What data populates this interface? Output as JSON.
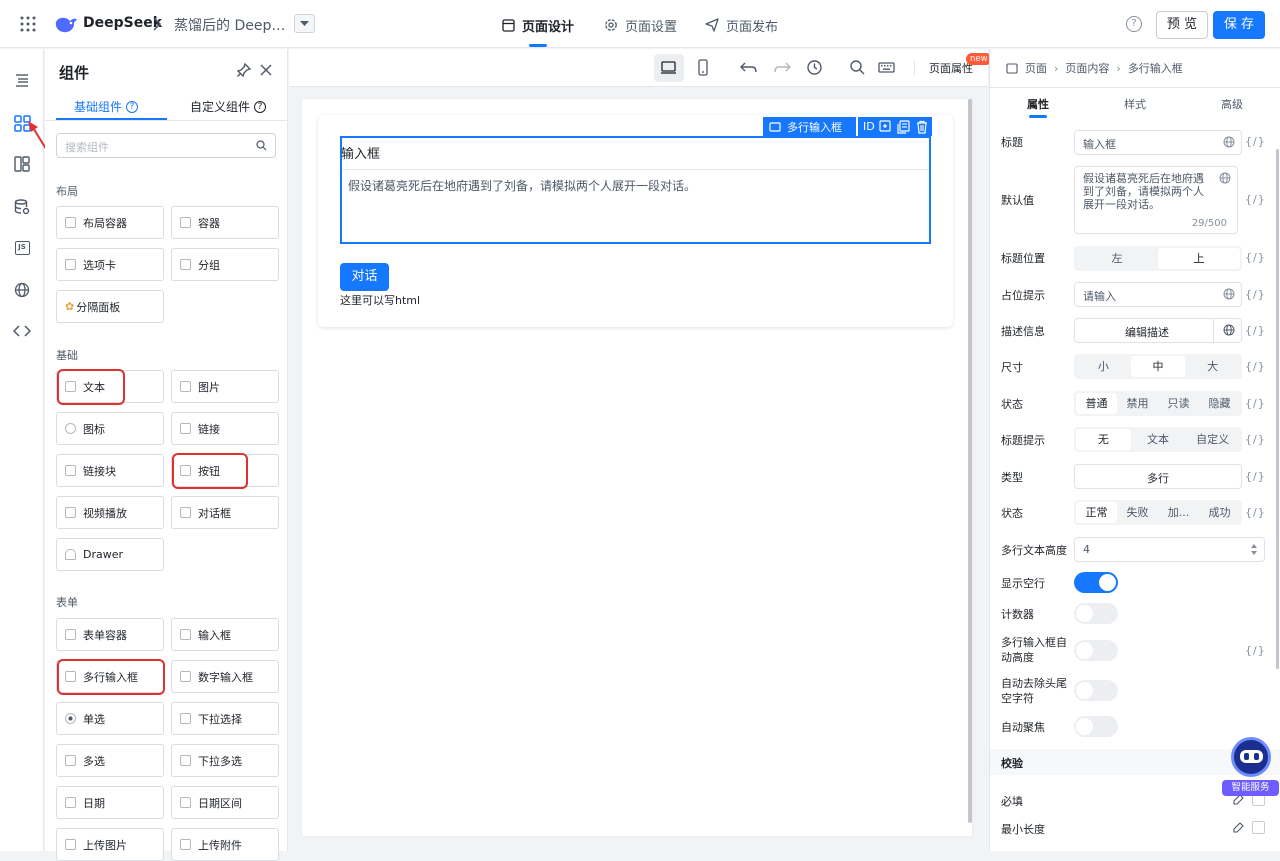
{
  "topbar": {
    "brand": "DeepSeek",
    "app_name": "蒸馏后的 DeepSeek",
    "tabs": [
      "页面设计",
      "页面设置",
      "页面发布"
    ],
    "help": "?",
    "preview": "预 览",
    "save": "保 存"
  },
  "rail": {
    "icons": [
      "outline-icon",
      "components-icon",
      "layout-icon",
      "datasource-icon",
      "js-icon",
      "globe-icon",
      "code-icon"
    ],
    "js_label": "JS"
  },
  "panel": {
    "title": "组件",
    "tabs": [
      "基础组件",
      "自定义组件"
    ],
    "search_placeholder": "搜索组件",
    "sections": {
      "layout": {
        "title": "布局",
        "items": [
          "布局容器",
          "容器",
          "选项卡",
          "分组",
          "分隔面板"
        ]
      },
      "basic": {
        "title": "基础",
        "items": [
          "文本",
          "图片",
          "图标",
          "链接",
          "链接块",
          "按钮",
          "视频播放",
          "对话框",
          "Drawer"
        ]
      },
      "form": {
        "title": "表单",
        "items": [
          "表单容器",
          "输入框",
          "多行输入框",
          "数字输入框",
          "单选",
          "下拉选择",
          "多选",
          "下拉多选",
          "日期",
          "日期区间",
          "上传图片",
          "上传附件"
        ]
      }
    }
  },
  "canvas_toolbar": {
    "page_props": "页面属性",
    "new_badge": "new"
  },
  "canvas": {
    "selected_label": "多行输入框",
    "id_label": "ID",
    "textarea_label": "输入框",
    "textarea_value": "假设诸葛亮死后在地府遇到了刘备，请模拟两个人展开一段对话。",
    "button_label": "对话",
    "html_note": "这里可以写html"
  },
  "props": {
    "breadcrumb": [
      "页面",
      "页面内容",
      "多行输入框"
    ],
    "tabs": [
      "属性",
      "样式",
      "高级"
    ],
    "fx": "{/}",
    "title_label": "标题",
    "title_value": "输入框",
    "default_label": "默认值",
    "default_value": "假设诸葛亮死后在地府遇到了刘备，请模拟两个人展开一段对话。",
    "default_count": "29/500",
    "title_pos_label": "标题位置",
    "title_pos": [
      "左",
      "上"
    ],
    "placeholder_label": "占位提示",
    "placeholder_value": "请输入",
    "desc_label": "描述信息",
    "desc_button": "编辑描述",
    "size_label": "尺寸",
    "size": [
      "小",
      "中",
      "大"
    ],
    "state_label": "状态",
    "state": [
      "普通",
      "禁用",
      "只读",
      "隐藏"
    ],
    "tip_label": "标题提示",
    "tip": [
      "无",
      "文本",
      "自定义"
    ],
    "type_label": "类型",
    "type_value": "多行",
    "status_label": "状态",
    "status": [
      "正常",
      "失败",
      "加...",
      "成功"
    ],
    "height_label": "多行文本高度",
    "height_value": "4",
    "show_empty_label": "显示空行",
    "counter_label": "计数器",
    "autoheight_label": "多行输入框自动高度",
    "trim_label": "自动去除头尾空字符",
    "autofocus_label": "自动聚焦",
    "validate_title": "校验",
    "required_label": "必填",
    "minlen_label": "最小长度"
  },
  "assistant": {
    "label": "智能服务"
  },
  "colors": {
    "accent": "#1677ff",
    "annotation": "#e03131",
    "assistant": "#6f5cff"
  }
}
